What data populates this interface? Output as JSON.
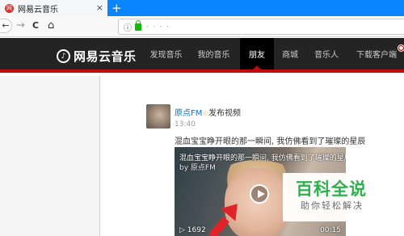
{
  "browser": {
    "tab_title": "网易云音乐",
    "tab_favicon": "网",
    "new_tab_label": "+",
    "close_label": "×",
    "back_label": "←",
    "forward_label": "→",
    "reload_label": "C",
    "home_label": "⌂",
    "url_info_label": "ⓘ",
    "url_text": "·  ·  ·  ·"
  },
  "site": {
    "logo_text": "网易云音乐",
    "logo_mark": "♪",
    "menu": [
      {
        "label": "发现音乐",
        "active": false
      },
      {
        "label": "我的音乐",
        "active": false
      },
      {
        "label": "朋友",
        "active": true
      },
      {
        "label": "商城",
        "active": false
      },
      {
        "label": "音乐人",
        "active": false
      },
      {
        "label": "下载客户端",
        "active": false
      }
    ],
    "badge": "●"
  },
  "post": {
    "author": "原点FM",
    "star": "☆",
    "action": "发布视频",
    "time": "13:40",
    "text": "混血宝宝睁开眼的那一瞬间, 我仿佛看到了璀璨的星辰",
    "video": {
      "title": "混血宝宝睁开眼的那一瞬间, 我仿佛看到了璀璨的星辰",
      "by": "by 原点FM",
      "plays": "▷ 1692",
      "duration": "00:15"
    }
  },
  "watermark": {
    "big": "百科全说",
    "small": "助你轻松解决"
  },
  "colors": {
    "accent": "#c20c0c",
    "header_bg": "#242424",
    "browser_blue": "#0a84ff",
    "link": "#0c73c2",
    "watermark_green": "#2bb24c"
  }
}
